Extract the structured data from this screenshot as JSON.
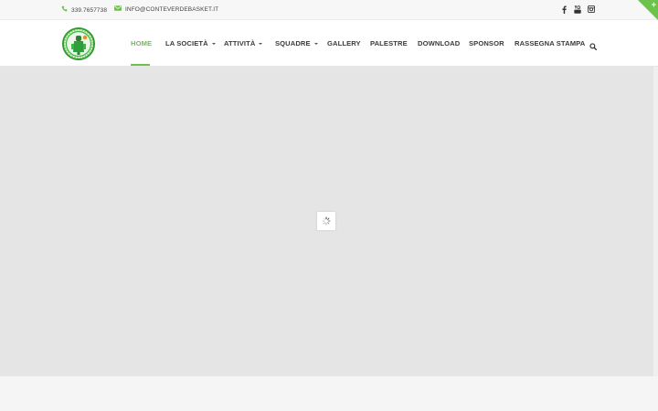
{
  "topbar": {
    "phone": "339.7657738",
    "email": "INFO@CONTEVERDEBASKET.IT",
    "social": [
      "facebook-icon",
      "youtube-icon",
      "instagram-icon"
    ]
  },
  "nav": {
    "items": [
      {
        "label": "HOME",
        "active": true,
        "dropdown": false
      },
      {
        "label": "LA SOCIETÀ",
        "active": false,
        "dropdown": true
      },
      {
        "label": "ATTIVITÀ",
        "active": false,
        "dropdown": true
      },
      {
        "label": "SQUADRE",
        "active": false,
        "dropdown": true
      },
      {
        "label": "GALLERY",
        "active": false,
        "dropdown": false
      },
      {
        "label": "PALESTRE",
        "active": false,
        "dropdown": false
      },
      {
        "label": "DOWNLOAD",
        "active": false,
        "dropdown": false
      },
      {
        "label": "SPONSOR",
        "active": false,
        "dropdown": false
      },
      {
        "label": "RASSEGNA STAMPA",
        "active": false,
        "dropdown": false
      }
    ]
  },
  "colors": {
    "accent": "#6cc24a",
    "nav_text": "#3a3a3a",
    "hero_bg": "#e5e5e5"
  }
}
